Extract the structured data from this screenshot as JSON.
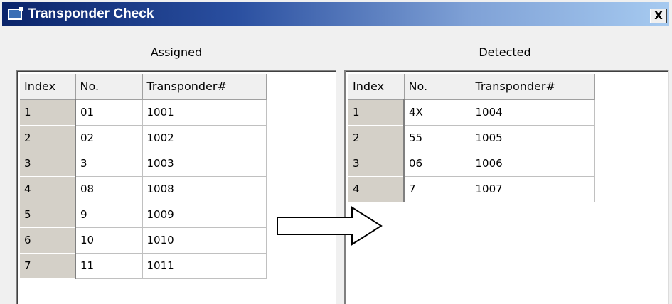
{
  "window": {
    "title": "Transponder Check",
    "close_label": "X"
  },
  "assigned": {
    "label": "Assigned",
    "columns": [
      "Index",
      "No.",
      "Transponder#"
    ],
    "rows": [
      {
        "index": "1",
        "no": "01",
        "transponder": "1001"
      },
      {
        "index": "2",
        "no": "02",
        "transponder": "1002"
      },
      {
        "index": "3",
        "no": "3",
        "transponder": "1003"
      },
      {
        "index": "4",
        "no": "08",
        "transponder": "1008"
      },
      {
        "index": "5",
        "no": "9",
        "transponder": "1009"
      },
      {
        "index": "6",
        "no": "10",
        "transponder": "1010"
      },
      {
        "index": "7",
        "no": "11",
        "transponder": "1011"
      }
    ]
  },
  "detected": {
    "label": "Detected",
    "columns": [
      "Index",
      "No.",
      "Transponder#"
    ],
    "rows": [
      {
        "index": "1",
        "no": "4X",
        "transponder": "1004"
      },
      {
        "index": "2",
        "no": "55",
        "transponder": "1005"
      },
      {
        "index": "3",
        "no": "06",
        "transponder": "1006"
      },
      {
        "index": "4",
        "no": "7",
        "transponder": "1007"
      }
    ]
  },
  "icons": {
    "app": "window-app-icon",
    "close": "close-icon",
    "arrow": "right-arrow-icon"
  },
  "colors": {
    "titlebar_start": "#0a246a",
    "titlebar_end": "#a6caf0",
    "index_cell_bg": "#d4d0c8"
  }
}
